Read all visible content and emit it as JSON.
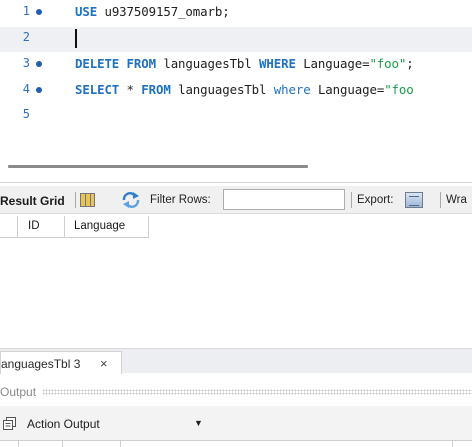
{
  "editor": {
    "current_line": 2,
    "lines": [
      {
        "num": "1",
        "marker": true,
        "tokens": [
          {
            "t": "USE",
            "c": "kw"
          },
          {
            "t": " u937509157_omarb;",
            "c": "id"
          }
        ]
      },
      {
        "num": "2",
        "marker": false,
        "tokens": []
      },
      {
        "num": "3",
        "marker": true,
        "tokens": [
          {
            "t": "DELETE FROM",
            "c": "kw"
          },
          {
            "t": " languagesTbl ",
            "c": "id"
          },
          {
            "t": "WHERE",
            "c": "kw"
          },
          {
            "t": " Language=",
            "c": "id"
          },
          {
            "t": "\"foo\"",
            "c": "str"
          },
          {
            "t": ";",
            "c": "id"
          }
        ]
      },
      {
        "num": "4",
        "marker": true,
        "tokens": [
          {
            "t": "SELECT",
            "c": "kw"
          },
          {
            "t": " * ",
            "c": "id"
          },
          {
            "t": "FROM",
            "c": "kw"
          },
          {
            "t": " languagesTbl ",
            "c": "id"
          },
          {
            "t": "where",
            "c": "kw2"
          },
          {
            "t": " Language=",
            "c": "id"
          },
          {
            "t": "\"foo",
            "c": "str"
          }
        ]
      },
      {
        "num": "5",
        "marker": false,
        "tokens": []
      }
    ]
  },
  "result_toolbar": {
    "result_grid_label": "Result Grid",
    "filter_label": "Filter Rows:",
    "filter_value": "",
    "export_label": "Export:",
    "wrap_label": "Wra"
  },
  "grid": {
    "columns": [
      "ID",
      "Language"
    ],
    "rows": []
  },
  "tab": {
    "label": "anguagesTbl 3",
    "close_glyph": "×"
  },
  "output": {
    "header_label": "Output",
    "selected_view": "Action Output",
    "dropdown_glyph": "▼"
  },
  "colors": {
    "keyword": "#1e72c2",
    "string": "#1a9b48",
    "line_number": "#2f6fbd"
  }
}
